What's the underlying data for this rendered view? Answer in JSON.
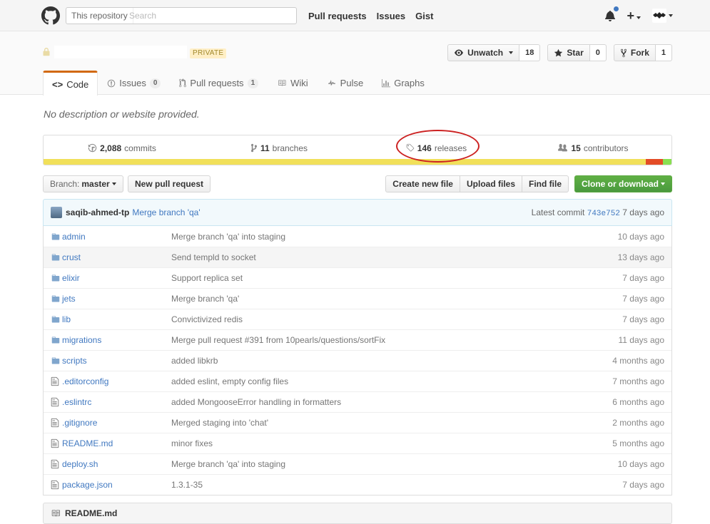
{
  "header": {
    "search_scope": "This repository",
    "search_placeholder": "Search",
    "nav": [
      "Pull requests",
      "Issues",
      "Gist"
    ]
  },
  "repo": {
    "visibility": "PRIVATE",
    "actions": {
      "watch_label": "Unwatch",
      "watch_count": "18",
      "star_label": "Star",
      "star_count": "0",
      "fork_label": "Fork",
      "fork_count": "1"
    },
    "tabs": [
      {
        "label": "Code",
        "counter": null,
        "selected": true
      },
      {
        "label": "Issues",
        "counter": "0"
      },
      {
        "label": "Pull requests",
        "counter": "1"
      },
      {
        "label": "Wiki",
        "counter": null
      },
      {
        "label": "Pulse",
        "counter": null
      },
      {
        "label": "Graphs",
        "counter": null
      }
    ],
    "description": "No description or website provided.",
    "summary": {
      "commits_num": "2,088",
      "commits_label": "commits",
      "branches_num": "11",
      "branches_label": "branches",
      "releases_num": "146",
      "releases_label": "releases",
      "contributors_num": "15",
      "contributors_label": "contributors"
    },
    "language_colors": [
      "#f1e05a",
      "#e34c26",
      "#89e051"
    ]
  },
  "filenav": {
    "branch_prefix": "Branch:",
    "branch_name": "master",
    "new_pr": "New pull request",
    "create_file": "Create new file",
    "upload_files": "Upload files",
    "find_file": "Find file",
    "clone": "Clone or download"
  },
  "latest_commit": {
    "author": "saqib-ahmed-tp",
    "message": "Merge branch 'qa'",
    "prefix": "Latest commit",
    "sha": "743e752",
    "age": "7 days ago"
  },
  "files": [
    {
      "type": "dir",
      "name": "admin",
      "message": "Merge branch 'qa' into staging",
      "age": "10 days ago"
    },
    {
      "type": "dir",
      "name": "crust",
      "message": "Send templd to socket",
      "age": "13 days ago"
    },
    {
      "type": "dir",
      "name": "elixir",
      "message": "Support replica set",
      "age": "7 days ago"
    },
    {
      "type": "dir",
      "name": "jets",
      "message": "Merge branch 'qa'",
      "age": "7 days ago"
    },
    {
      "type": "dir",
      "name": "lib",
      "message": "Convictivized redis",
      "age": "7 days ago"
    },
    {
      "type": "dir",
      "name": "migrations",
      "message": "Merge pull request #391 from 10pearls/questions/sortFix",
      "age": "11 days ago"
    },
    {
      "type": "dir",
      "name": "scripts",
      "message": "added libkrb",
      "age": "4 months ago"
    },
    {
      "type": "file",
      "name": ".editorconfig",
      "message": "added eslint, empty config files",
      "age": "7 months ago"
    },
    {
      "type": "file",
      "name": ".eslintrc",
      "message": "added MongooseError handling in formatters",
      "age": "6 months ago"
    },
    {
      "type": "file",
      "name": ".gitignore",
      "message": "Merged staging into 'chat'",
      "age": "2 months ago"
    },
    {
      "type": "file",
      "name": "README.md",
      "message": "minor fixes",
      "age": "5 months ago"
    },
    {
      "type": "file",
      "name": "deploy.sh",
      "message": "Merge branch 'qa' into staging",
      "age": "10 days ago"
    },
    {
      "type": "file",
      "name": "package.json",
      "message": "1.3.1-35",
      "age": "7 days ago"
    }
  ],
  "readme": {
    "title": "README.md"
  }
}
